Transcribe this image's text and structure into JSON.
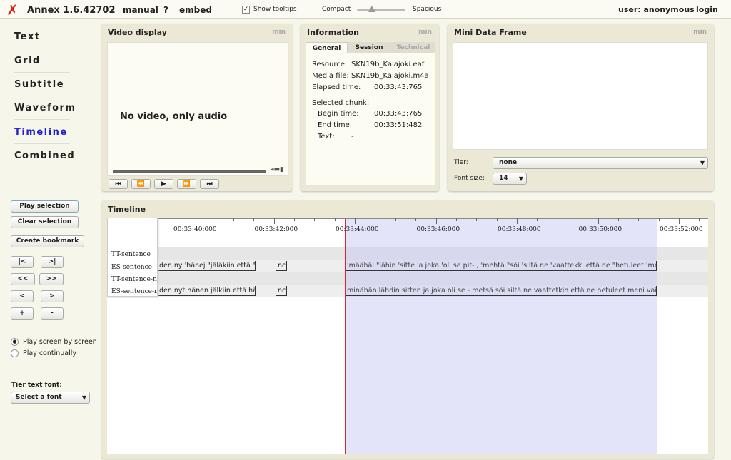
{
  "topbar": {
    "app": "Annex 1.6.42702",
    "manual": "manual",
    "help": "?",
    "embed": "embed",
    "tooltips": "Show tooltips",
    "tooltips_checked": true,
    "compact": "Compact",
    "spacious": "Spacious",
    "density": 0.3,
    "user": "user: anonymous",
    "login": "login"
  },
  "nav": [
    "Text",
    "Grid",
    "Subtitle",
    "Waveform",
    "Timeline",
    "Combined"
  ],
  "nav_active": "Timeline",
  "video": {
    "title": "Video display",
    "min": "min",
    "message": "No video, only audio"
  },
  "info": {
    "title": "Information",
    "min": "min",
    "tabs": [
      "General",
      "Session",
      "Technical"
    ],
    "resource_label": "Resource:",
    "resource": "SKN19b_Kalajoki.eaf",
    "media_label": "Media file:",
    "media": "SKN19b_Kalajoki.m4a",
    "elapsed_label": "Elapsed time:",
    "elapsed": "00:33:43:765",
    "chunk_label": "Selected chunk:",
    "begin_label": "Begin time:",
    "begin": "00:33:43:765",
    "end_label": "End time:",
    "end": "00:33:51:482",
    "text_label": "Text:",
    "text": "-"
  },
  "mini": {
    "title": "Mini Data Frame",
    "min": "min",
    "tier_label": "Tier:",
    "tier": "none",
    "font_label": "Font size:",
    "font": "14"
  },
  "controls": {
    "play_selection": "Play selection",
    "clear_selection": "Clear selection",
    "create_bookmark": "Create bookmark",
    "nav_buttons": [
      "|<",
      ">|",
      "<<",
      ">>",
      "<",
      ">",
      "+",
      "-"
    ],
    "radio1": "Play screen by screen",
    "radio2": "Play continually",
    "font_label": "Tier text font:",
    "font_select": "Select a font"
  },
  "timeline": {
    "title": "Timeline",
    "ticks": [
      "00:33:40:000",
      "00:33:42:000",
      "00:33:44:000",
      "00:33:46:000",
      "00:33:48:000",
      "00:33:50:000",
      "00:33:52:000"
    ],
    "tiers": [
      "TT-sentence",
      "ES-sentence",
      "TT-sentence-no",
      "ES-sentence-no"
    ],
    "es_before": "den ny 'hänej \"jäläkiin että \"hää 'c",
    "es_nc": "nc",
    "es_sel": "'määhäl \"lähin 'sitte 'a joka 'oli se pit- , 'mehtä \"söi 'siltä ne 'vaattekki että ne \"hetuleet 'meni väj \"jälisä r",
    "esno_before": "den nyt hänen jälkiin että hän op",
    "esno_nc": "nc",
    "esno_sel": "minähän lähdin sitten ja joka oli se - metsä söi siltä ne vaattetkin että ne hetuleet meni vain jäljissä niin"
  }
}
